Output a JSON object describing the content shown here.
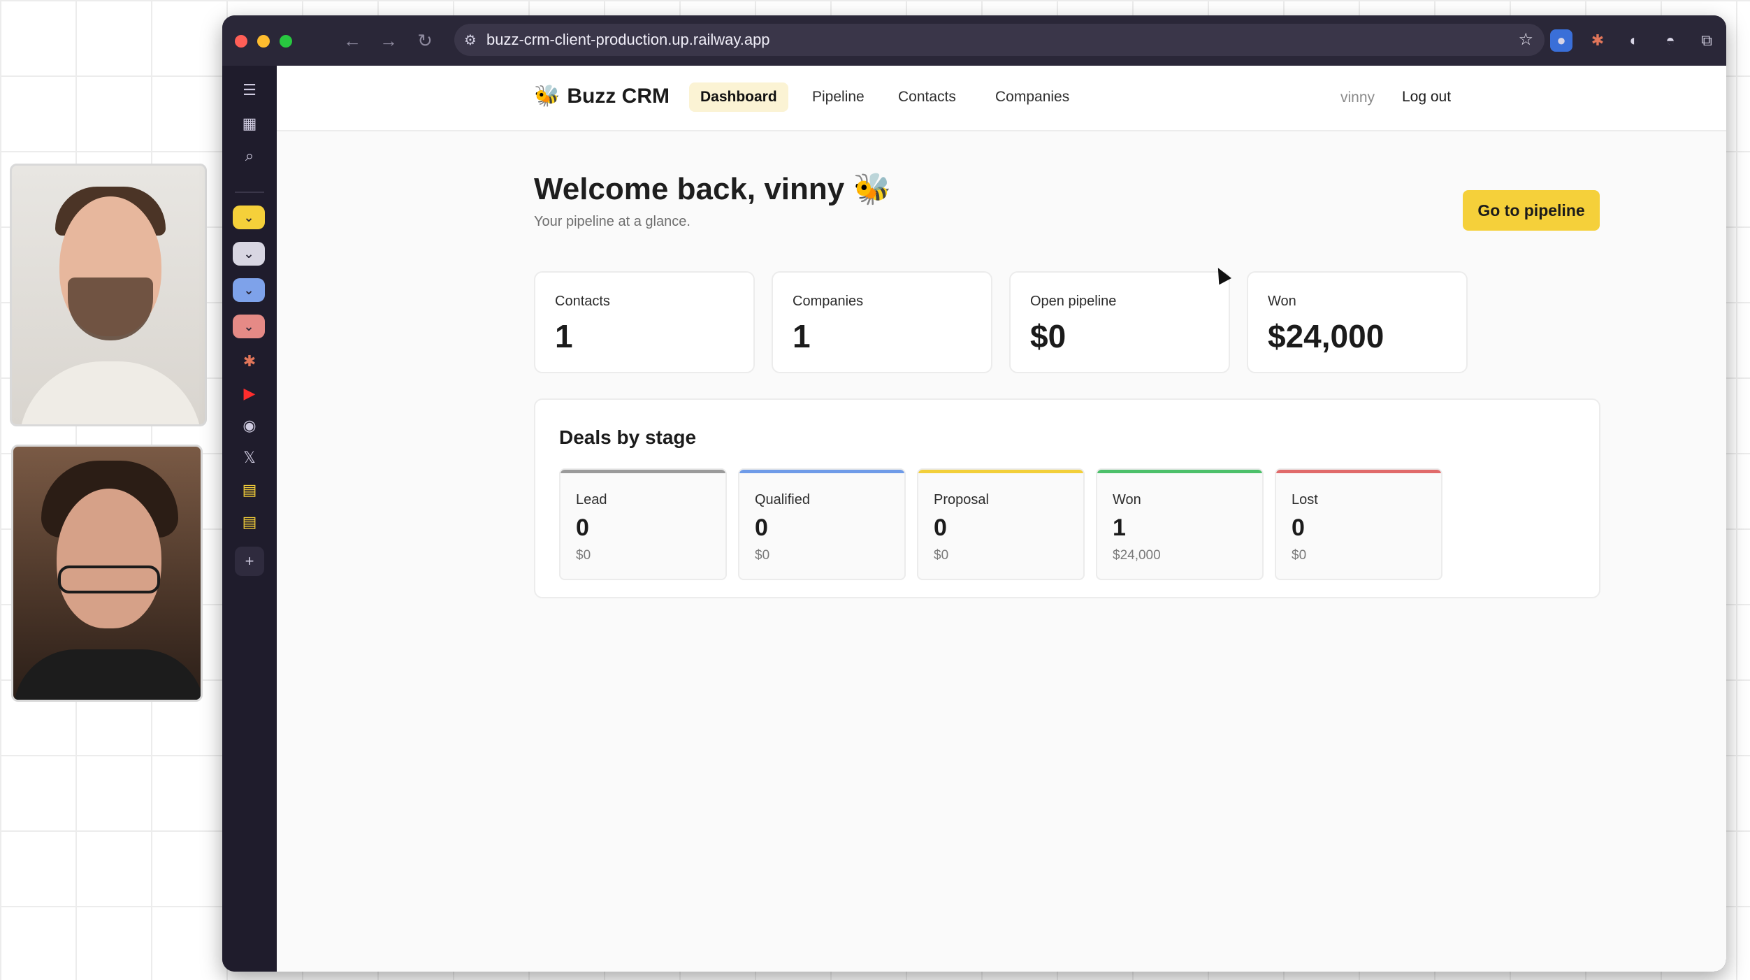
{
  "browser": {
    "url": "buzz-crm-client-production.up.railway.app"
  },
  "app": {
    "brand": "Buzz CRM",
    "brand_icon": "🐝",
    "nav": [
      {
        "label": "Dashboard",
        "active": true
      },
      {
        "label": "Pipeline",
        "active": false
      },
      {
        "label": "Contacts",
        "active": false
      },
      {
        "label": "Companies",
        "active": false
      }
    ],
    "user": "vinny",
    "logout": "Log out"
  },
  "header": {
    "title": "Welcome back, vinny 🐝",
    "subtitle": "Your pipeline at a glance.",
    "cta": "Go to pipeline"
  },
  "stats": [
    {
      "label": "Contacts",
      "value": "1"
    },
    {
      "label": "Companies",
      "value": "1"
    },
    {
      "label": "Open pipeline",
      "value": "$0"
    },
    {
      "label": "Won",
      "value": "$24,000"
    }
  ],
  "deals": {
    "title": "Deals by stage",
    "stages": [
      {
        "name": "Lead",
        "count": "0",
        "amount": "$0",
        "color": "#9a9a9a"
      },
      {
        "name": "Qualified",
        "count": "0",
        "amount": "$0",
        "color": "#6f9be8"
      },
      {
        "name": "Proposal",
        "count": "0",
        "amount": "$0",
        "color": "#f2cf3a"
      },
      {
        "name": "Won",
        "count": "1",
        "amount": "$24,000",
        "color": "#4cc06a"
      },
      {
        "name": "Lost",
        "count": "0",
        "amount": "$0",
        "color": "#e06a6a"
      }
    ]
  },
  "colors": {
    "accent": "#f5d03a",
    "active_nav_bg": "#fbf3d4"
  }
}
